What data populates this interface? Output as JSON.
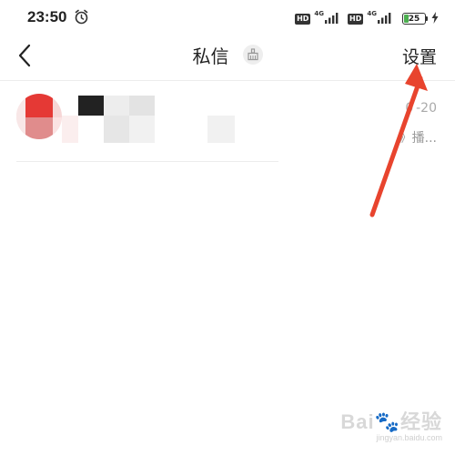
{
  "status_bar": {
    "time": "23:50",
    "hd_label": "HD",
    "network_label": "4G",
    "battery_level": "25",
    "icons": [
      "alarm-icon",
      "signal-icon",
      "signal-icon",
      "charging-icon"
    ]
  },
  "nav": {
    "back_icon": "chevron-left-icon",
    "title": "私信",
    "clear_icon": "broom-icon",
    "settings_label": "设置"
  },
  "conversation": {
    "date": "0 -20",
    "preview": "》播..."
  },
  "watermark": {
    "brand": "Bai",
    "brand_suffix": "经验",
    "url": "jingyan.baidu.com"
  },
  "colors": {
    "accent": "#e8442e",
    "battery": "#4caf50",
    "text": "#222222",
    "muted": "#999999"
  }
}
